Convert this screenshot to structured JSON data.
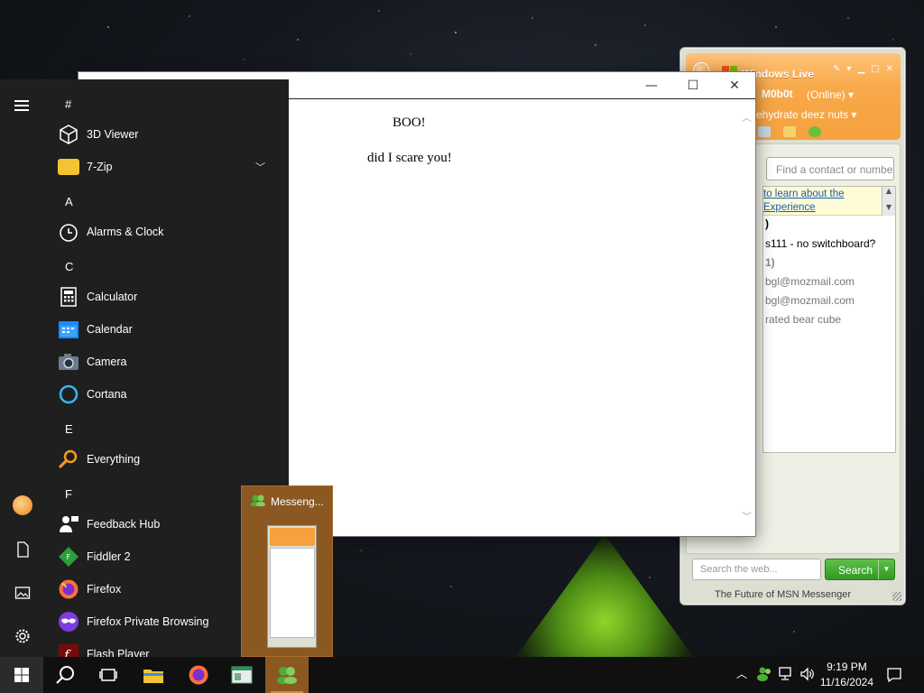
{
  "document_window": {
    "line1": "BOO!",
    "line2": "did I scare you!"
  },
  "messenger": {
    "title": "Windows Live",
    "nickname": "M0b0t",
    "status": "(Online)",
    "personal_message": "ehydrate deez nuts",
    "search_contacts_placeholder": "Find a contact or numbe",
    "banner_text": "to learn about the Experience",
    "contacts": [
      ")",
      "s111 - no switchboard?",
      "1)",
      "bgl@mozmail.com",
      "bgl@mozmail.com",
      "rated bear cube"
    ],
    "web_search_placeholder": "Search the web...",
    "search_button": "Search",
    "footer": "The Future of MSN Messenger",
    "accent_color": "#f5a13e"
  },
  "start_menu": {
    "groups": [
      {
        "letter": "#",
        "apps": [
          {
            "label": "3D Viewer",
            "icon": "cube-icon"
          },
          {
            "label": "7-Zip",
            "icon": "folder-icon",
            "expandable": true
          }
        ]
      },
      {
        "letter": "A",
        "apps": [
          {
            "label": "Alarms & Clock",
            "icon": "alarm-clock-icon"
          }
        ]
      },
      {
        "letter": "C",
        "apps": [
          {
            "label": "Calculator",
            "icon": "calculator-icon"
          },
          {
            "label": "Calendar",
            "icon": "calendar-icon"
          },
          {
            "label": "Camera",
            "icon": "camera-icon"
          },
          {
            "label": "Cortana",
            "icon": "cortana-icon"
          }
        ]
      },
      {
        "letter": "E",
        "apps": [
          {
            "label": "Everything",
            "icon": "magnifier-icon"
          }
        ]
      },
      {
        "letter": "F",
        "apps": [
          {
            "label": "Feedback Hub",
            "icon": "feedback-icon"
          },
          {
            "label": "Fiddler 2",
            "icon": "fiddler-icon"
          },
          {
            "label": "Firefox",
            "icon": "firefox-icon"
          },
          {
            "label": "Firefox Private Browsing",
            "icon": "private-browsing-icon"
          },
          {
            "label": "Flash Player",
            "icon": "flash-icon"
          }
        ]
      }
    ]
  },
  "taskbar_preview": {
    "title": "Messeng..."
  },
  "taskbar": {
    "time": "9:19 PM",
    "date": "11/16/2024"
  }
}
